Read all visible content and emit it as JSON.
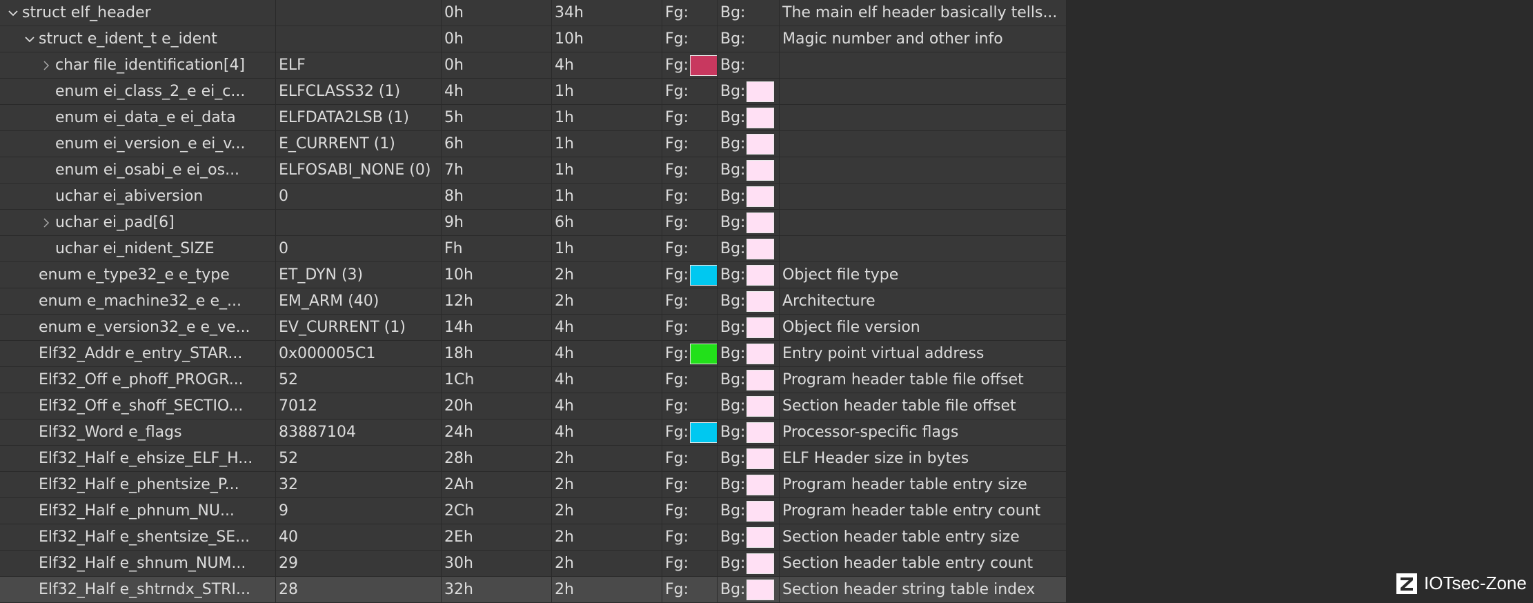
{
  "rows": [
    {
      "depth": 0,
      "expander": "open",
      "name": "struct elf_header",
      "value": "",
      "start": "0h",
      "size": "34h",
      "fg": "Fg:",
      "bg": "Bg:",
      "fg_color": "",
      "bg_color": "",
      "comment": "The main elf header basically tells..."
    },
    {
      "depth": 1,
      "expander": "open",
      "name": "struct e_ident_t e_ident",
      "value": "",
      "start": "0h",
      "size": "10h",
      "fg": "Fg:",
      "bg": "Bg:",
      "fg_color": "",
      "bg_color": "",
      "comment": "Magic number and other info"
    },
    {
      "depth": 2,
      "expander": "closed",
      "name": "char file_identification[4]",
      "value": "ELF",
      "start": "0h",
      "size": "4h",
      "fg": "Fg:",
      "bg": "Bg:",
      "fg_color": "#c8385f",
      "bg_color": "",
      "comment": ""
    },
    {
      "depth": 2,
      "expander": "none",
      "name": "enum ei_class_2_e ei_c...",
      "value": "ELFCLASS32 (1)",
      "start": "4h",
      "size": "1h",
      "fg": "Fg:",
      "bg": "Bg:",
      "fg_color": "",
      "bg_color": "#ffe0f4",
      "comment": ""
    },
    {
      "depth": 2,
      "expander": "none",
      "name": "enum ei_data_e ei_data",
      "value": "ELFDATA2LSB (1)",
      "start": "5h",
      "size": "1h",
      "fg": "Fg:",
      "bg": "Bg:",
      "fg_color": "",
      "bg_color": "#ffe0f4",
      "comment": ""
    },
    {
      "depth": 2,
      "expander": "none",
      "name": "enum ei_version_e ei_v...",
      "value": "E_CURRENT (1)",
      "start": "6h",
      "size": "1h",
      "fg": "Fg:",
      "bg": "Bg:",
      "fg_color": "",
      "bg_color": "#ffe0f4",
      "comment": ""
    },
    {
      "depth": 2,
      "expander": "none",
      "name": "enum ei_osabi_e ei_os...",
      "value": "ELFOSABI_NONE (0)",
      "start": "7h",
      "size": "1h",
      "fg": "Fg:",
      "bg": "Bg:",
      "fg_color": "",
      "bg_color": "#ffe0f4",
      "comment": ""
    },
    {
      "depth": 2,
      "expander": "none",
      "name": "uchar ei_abiversion",
      "value": "0",
      "start": "8h",
      "size": "1h",
      "fg": "Fg:",
      "bg": "Bg:",
      "fg_color": "",
      "bg_color": "#ffe0f4",
      "comment": ""
    },
    {
      "depth": 2,
      "expander": "closed",
      "name": "uchar ei_pad[6]",
      "value": "",
      "start": "9h",
      "size": "6h",
      "fg": "Fg:",
      "bg": "Bg:",
      "fg_color": "",
      "bg_color": "#ffe0f4",
      "comment": ""
    },
    {
      "depth": 2,
      "expander": "none",
      "name": "uchar ei_nident_SIZE",
      "value": "0",
      "start": "Fh",
      "size": "1h",
      "fg": "Fg:",
      "bg": "Bg:",
      "fg_color": "",
      "bg_color": "#ffe0f4",
      "comment": ""
    },
    {
      "depth": 1,
      "expander": "none",
      "name": "enum e_type32_e e_type",
      "value": "ET_DYN (3)",
      "start": "10h",
      "size": "2h",
      "fg": "Fg:",
      "bg": "Bg:",
      "fg_color": "#00c8f0",
      "bg_color": "#ffe0f4",
      "comment": "Object file type"
    },
    {
      "depth": 1,
      "expander": "none",
      "name": "enum e_machine32_e e_...",
      "value": "EM_ARM (40)",
      "start": "12h",
      "size": "2h",
      "fg": "Fg:",
      "bg": "Bg:",
      "fg_color": "",
      "bg_color": "#ffe0f4",
      "comment": "Architecture"
    },
    {
      "depth": 1,
      "expander": "none",
      "name": "enum e_version32_e e_ve...",
      "value": "EV_CURRENT (1)",
      "start": "14h",
      "size": "4h",
      "fg": "Fg:",
      "bg": "Bg:",
      "fg_color": "",
      "bg_color": "#ffe0f4",
      "comment": "Object file version"
    },
    {
      "depth": 1,
      "expander": "none",
      "name": "Elf32_Addr e_entry_STAR...",
      "value": "0x000005C1",
      "start": "18h",
      "size": "4h",
      "fg": "Fg:",
      "bg": "Bg:",
      "fg_color": "#22e01a",
      "bg_color": "#ffe0f4",
      "comment": "Entry point virtual address"
    },
    {
      "depth": 1,
      "expander": "none",
      "name": "Elf32_Off e_phoff_PROGR...",
      "value": "52",
      "start": "1Ch",
      "size": "4h",
      "fg": "Fg:",
      "bg": "Bg:",
      "fg_color": "",
      "bg_color": "#ffe0f4",
      "comment": "Program header table file offset"
    },
    {
      "depth": 1,
      "expander": "none",
      "name": "Elf32_Off e_shoff_SECTIO...",
      "value": "7012",
      "start": "20h",
      "size": "4h",
      "fg": "Fg:",
      "bg": "Bg:",
      "fg_color": "",
      "bg_color": "#ffe0f4",
      "comment": "Section header table file offset"
    },
    {
      "depth": 1,
      "expander": "none",
      "name": "Elf32_Word e_flags",
      "value": "83887104",
      "start": "24h",
      "size": "4h",
      "fg": "Fg:",
      "bg": "Bg:",
      "fg_color": "#00c8f0",
      "bg_color": "#ffe0f4",
      "comment": "Processor-specific flags"
    },
    {
      "depth": 1,
      "expander": "none",
      "name": "Elf32_Half e_ehsize_ELF_H...",
      "value": "52",
      "start": "28h",
      "size": "2h",
      "fg": "Fg:",
      "bg": "Bg:",
      "fg_color": "",
      "bg_color": "#ffe0f4",
      "comment": "ELF Header size in bytes"
    },
    {
      "depth": 1,
      "expander": "none",
      "name": "Elf32_Half e_phentsize_P...",
      "value": "32",
      "start": "2Ah",
      "size": "2h",
      "fg": "Fg:",
      "bg": "Bg:",
      "fg_color": "",
      "bg_color": "#ffe0f4",
      "comment": "Program header table entry size"
    },
    {
      "depth": 1,
      "expander": "none",
      "name": "Elf32_Half e_phnum_NU...",
      "value": "9",
      "start": "2Ch",
      "size": "2h",
      "fg": "Fg:",
      "bg": "Bg:",
      "fg_color": "",
      "bg_color": "#ffe0f4",
      "comment": "Program header table entry count"
    },
    {
      "depth": 1,
      "expander": "none",
      "name": "Elf32_Half e_shentsize_SE...",
      "value": "40",
      "start": "2Eh",
      "size": "2h",
      "fg": "Fg:",
      "bg": "Bg:",
      "fg_color": "",
      "bg_color": "#ffe0f4",
      "comment": "Section header table entry size"
    },
    {
      "depth": 1,
      "expander": "none",
      "name": "Elf32_Half e_shnum_NUM...",
      "value": "29",
      "start": "30h",
      "size": "2h",
      "fg": "Fg:",
      "bg": "Bg:",
      "fg_color": "",
      "bg_color": "#ffe0f4",
      "comment": "Section header table entry count"
    },
    {
      "depth": 1,
      "expander": "none",
      "name": "Elf32_Half e_shtrndx_STRI...",
      "value": "28",
      "start": "32h",
      "size": "2h",
      "fg": "Fg:",
      "bg": "Bg:",
      "fg_color": "",
      "bg_color": "#ffe0f4",
      "comment": "Section header string table index",
      "selected": true
    }
  ],
  "icons": {
    "open": "chevron-down-icon",
    "closed": "chevron-right-icon"
  },
  "watermark": {
    "text": "IOTsec-Zone",
    "logo_icon": "z-logo-icon"
  }
}
